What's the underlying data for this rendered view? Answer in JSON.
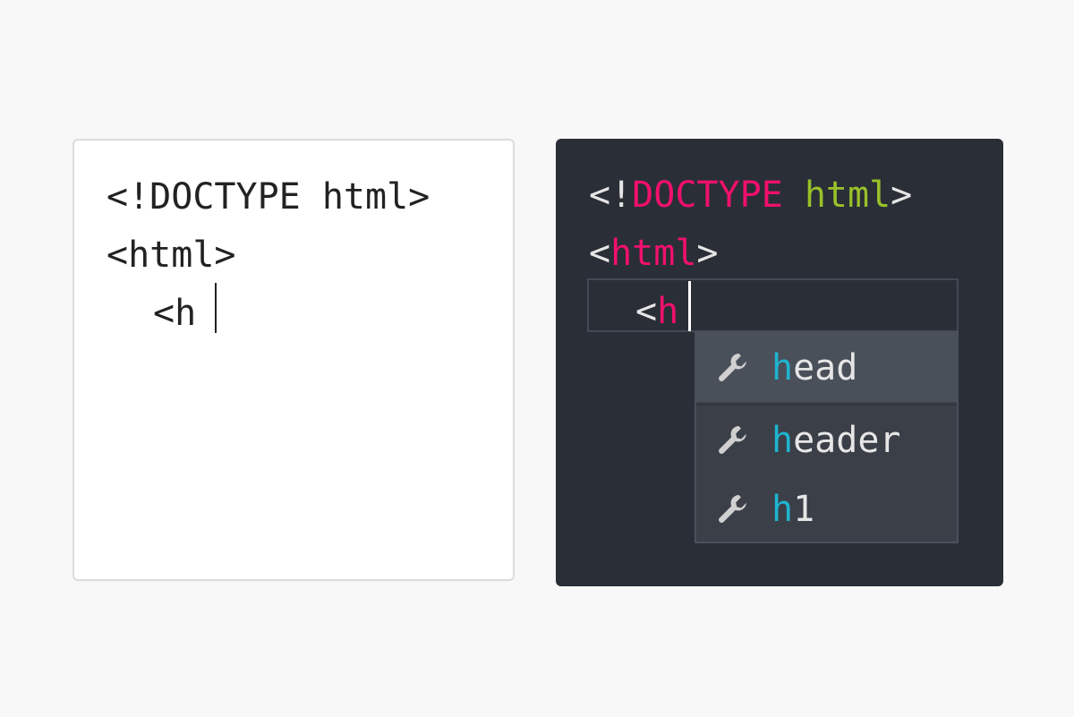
{
  "plain_editor": {
    "lines": [
      "<!DOCTYPE html>",
      "<html>",
      "<h"
    ]
  },
  "dark_editor": {
    "line1": {
      "open": "<!",
      "keyword": "DOCTYPE",
      "attr": "html",
      "close": ">"
    },
    "line2": {
      "open": "<",
      "tag": "html",
      "close": ">"
    },
    "line3": {
      "open": "<",
      "tag": "h"
    }
  },
  "autocomplete": {
    "icon": "wrench-icon",
    "items": [
      {
        "match": "h",
        "rest": "ead",
        "selected": true
      },
      {
        "match": "h",
        "rest": "eader",
        "selected": false
      },
      {
        "match": "h",
        "rest": "1",
        "selected": false
      }
    ]
  },
  "colors": {
    "keyword": "#f0106d",
    "attribute": "#98c12a",
    "match": "#1fb4cf",
    "dark_background": "#2a2e36"
  }
}
